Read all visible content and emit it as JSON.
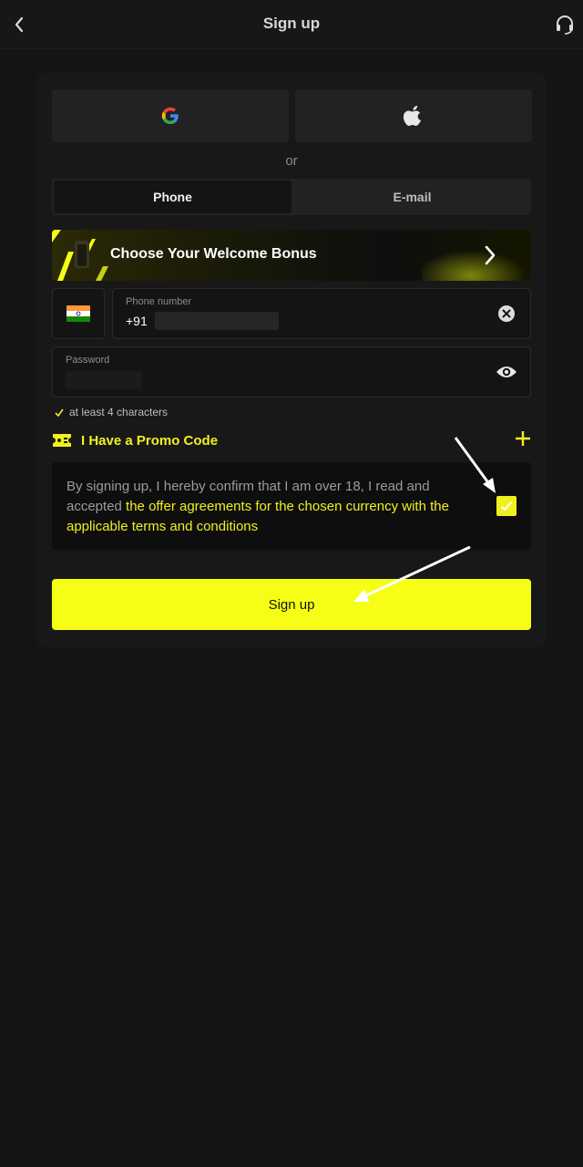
{
  "header": {
    "title": "Sign up",
    "back_icon": "chevron-left-icon",
    "support_icon": "headset-icon"
  },
  "social": {
    "google_icon": "google-icon",
    "apple_icon": "apple-icon"
  },
  "divider_text": "or",
  "tabs": [
    {
      "label": "Phone",
      "active": true
    },
    {
      "label": "E-mail",
      "active": false
    }
  ],
  "bonus": {
    "label": "Choose Your Welcome Bonus"
  },
  "phone": {
    "label": "Phone number",
    "value": "+91"
  },
  "password": {
    "label": "Password"
  },
  "password_hint": "at least 4 characters",
  "promo": {
    "label": "I Have a Promo Code"
  },
  "terms": {
    "text_plain": "By signing up, I hereby confirm that I am over 18, I read and accepted ",
    "text_link": "the offer agreements for the chosen currency with the applicable terms and conditions",
    "checked": true
  },
  "signup_button": "Sign up",
  "colors": {
    "accent": "#f5fe14",
    "background": "#141414",
    "card": "#181818"
  }
}
